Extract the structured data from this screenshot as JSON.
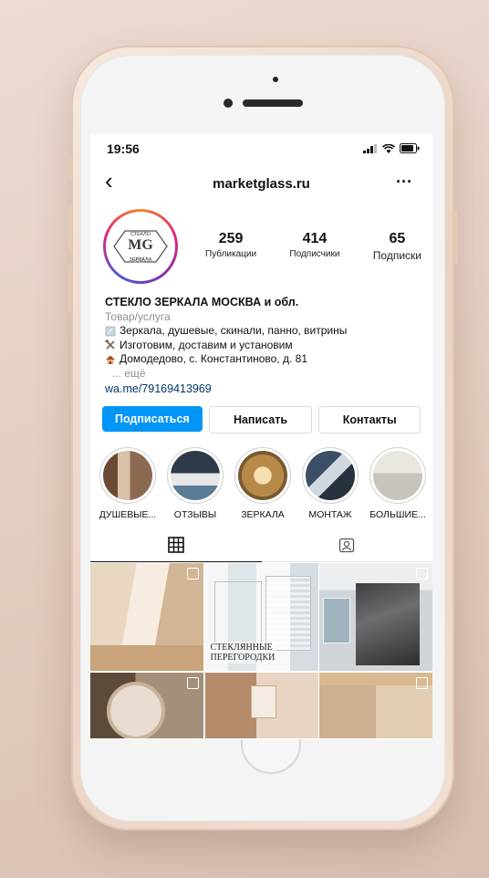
{
  "status": {
    "time": "19:56"
  },
  "profile": {
    "username": "marketglass.ru",
    "logo_text": [
      "СТЕКЛО",
      "MG",
      "ЗЕРКАЛА"
    ],
    "stats": [
      {
        "num": "259",
        "label": "Публикации"
      },
      {
        "num": "414",
        "label": "Подписчики"
      },
      {
        "num": "65",
        "label": "Подписки"
      }
    ]
  },
  "bio": {
    "name": "СТЕКЛО ЗЕРКАЛА МОСКВА и обл.",
    "category": "Товар/услуга",
    "lines": [
      {
        "icon": "mirror-icon",
        "text": "Зеркала, душевые, скинали, панно, витрины"
      },
      {
        "icon": "tools-icon",
        "text": "Изготовим, доставим и установим"
      },
      {
        "icon": "house-icon",
        "text": "Домодедово, с. Константиново, д. 81"
      }
    ],
    "more": "... ещё",
    "link": "wa.me/79169413969"
  },
  "buttons": {
    "follow": "Подписаться",
    "message": "Написать",
    "contacts": "Контакты"
  },
  "highlights": [
    "ДУШЕВЫЕ...",
    "ОТЗЫВЫ",
    "ЗЕРКАЛА",
    "МОНТАЖ",
    "БОЛЬШИЕ..."
  ],
  "grid": {
    "overlay_text": [
      "СТЕКЛЯННЫЕ",
      "ПЕРЕГОРОДКИ"
    ]
  },
  "colors": {
    "accent": "#0095f6",
    "link": "#00376b",
    "muted": "#8e8e8e"
  }
}
